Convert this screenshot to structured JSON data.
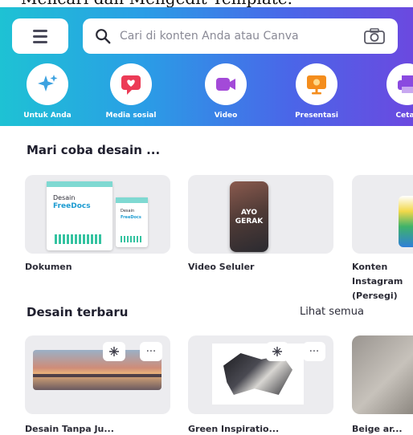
{
  "caption": "Mencari dan Mengedit Template.",
  "search": {
    "placeholder": "Cari di konten Anda atau Canva"
  },
  "categories": [
    {
      "label": "Untuk Anda",
      "icon": "sparkle-icon",
      "color": "#3da2e0"
    },
    {
      "label": "Media sosial",
      "icon": "heart-message-icon",
      "color": "#ec3b56"
    },
    {
      "label": "Video",
      "icon": "video-camera-icon",
      "color": "#a34ad8"
    },
    {
      "label": "Presentasi",
      "icon": "presentation-icon",
      "color": "#f48d1c"
    },
    {
      "label": "Cetak",
      "icon": "print-icon",
      "color": "#8a4ae0"
    }
  ],
  "try_design": {
    "title": "Mari coba desain ...",
    "items": [
      {
        "label": "Dokumen",
        "preview": {
          "title": "Desain",
          "subtitle": "FreeDocs",
          "mini_title": "Desain",
          "mini_sub": "FreeDocs"
        }
      },
      {
        "label": "Video Seluler",
        "preview": {
          "line1": "AYO",
          "line2": "GERAK"
        }
      },
      {
        "label": "Konten Instagram (Persegi)"
      }
    ]
  },
  "recent": {
    "title": "Desain terbaru",
    "see_all": "Lihat semua",
    "items": [
      {
        "label": "Desain Tanpa Ju..."
      },
      {
        "label": "Green Inspiratio..."
      },
      {
        "label": "Beige ar..."
      }
    ]
  },
  "badge": {
    "more": "···"
  }
}
